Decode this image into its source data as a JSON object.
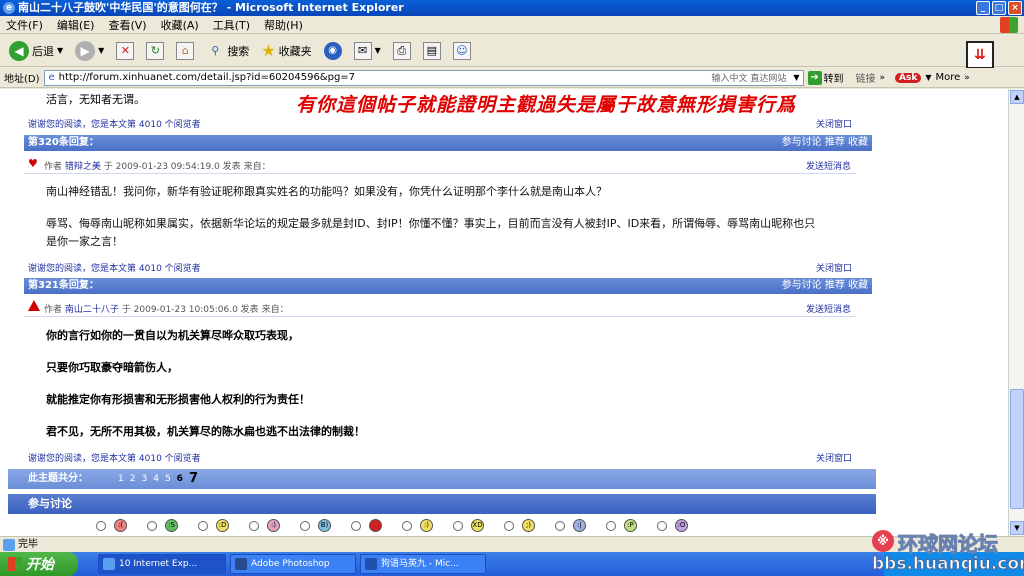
{
  "window": {
    "title": "南山二十八子鼓吹'中华民国'的意图何在？ - Microsoft Internet Explorer"
  },
  "menu": [
    "文件(F)",
    "编辑(E)",
    "查看(V)",
    "收藏(A)",
    "工具(T)",
    "帮助(H)"
  ],
  "toolbar": {
    "back": "后退",
    "search": "搜索",
    "favorites": "收藏夹"
  },
  "address": {
    "label": "地址(D)",
    "url": "http://forum.xinhuanet.com/detail.jsp?id=60204596&pg=7",
    "ime": "输入中文 直达网站",
    "go": "转到",
    "links": "链接",
    "more": "More"
  },
  "overlay": "有你這個帖子就能證明主觀過失是屬于故意無形損害行爲",
  "prev_tail": "活言，无知者无谓。",
  "meta_label": "谢谢您的阅读，您是本文第",
  "meta_count": "4010",
  "meta_suffix": "个阅览者",
  "close_window": "关闭窗口",
  "send_msg": "发送短消息",
  "reply_actions": "参与讨论  推荐  收藏",
  "reply320": {
    "header": "第320条回复：",
    "author_label": "作者",
    "author": "错辩之美",
    "time": "于 2009-01-23 09:54:19.0 发表",
    "source": "来自：",
    "lines": [
      "南山神经错乱！我问你，新华有验证昵称跟真实姓名的功能吗？如果没有，你凭什么证明那个李什么就是南山本人？",
      "辱骂、侮辱南山昵称如果属实，依据新华论坛的规定最多就是封ID、封IP！你懂不懂？事实上，目前而言没有人被封IP、ID来看，所谓侮辱、辱骂南山昵称也只",
      "是你一家之言！"
    ]
  },
  "reply321": {
    "header": "第321条回复：",
    "author_label": "作者",
    "author": "南山二十八子",
    "time": "于 2009-01-23 10:05:06.0 发表",
    "source": "来自：",
    "lines": [
      "你的言行如你的一贯自以为机关算尽哗众取巧表现，",
      "只要你巧取豪夺暗箭伤人，",
      "就能推定你有形损害和无形损害他人权利的行为责任！",
      "君不见，无所不用其极，机关算尽的陈水扁也逃不出法律的制裁！"
    ]
  },
  "pagebar": {
    "label": "此主题共分：",
    "pages": [
      "1",
      "2",
      "3",
      "4",
      "5",
      "6"
    ],
    "current": "7"
  },
  "discuss": "参与讨论",
  "status": "完毕",
  "taskbar": {
    "start": "开始",
    "tasks": [
      "10 Internet Exp...",
      "Adobe Photoshop",
      "狗语马英九 - Mic..."
    ]
  },
  "watermark": {
    "cn": "环球网论坛",
    "url": "bbs.huanqiu.com"
  },
  "colors": {
    "accent": "#4a70c8",
    "overlay": "#e00000"
  }
}
